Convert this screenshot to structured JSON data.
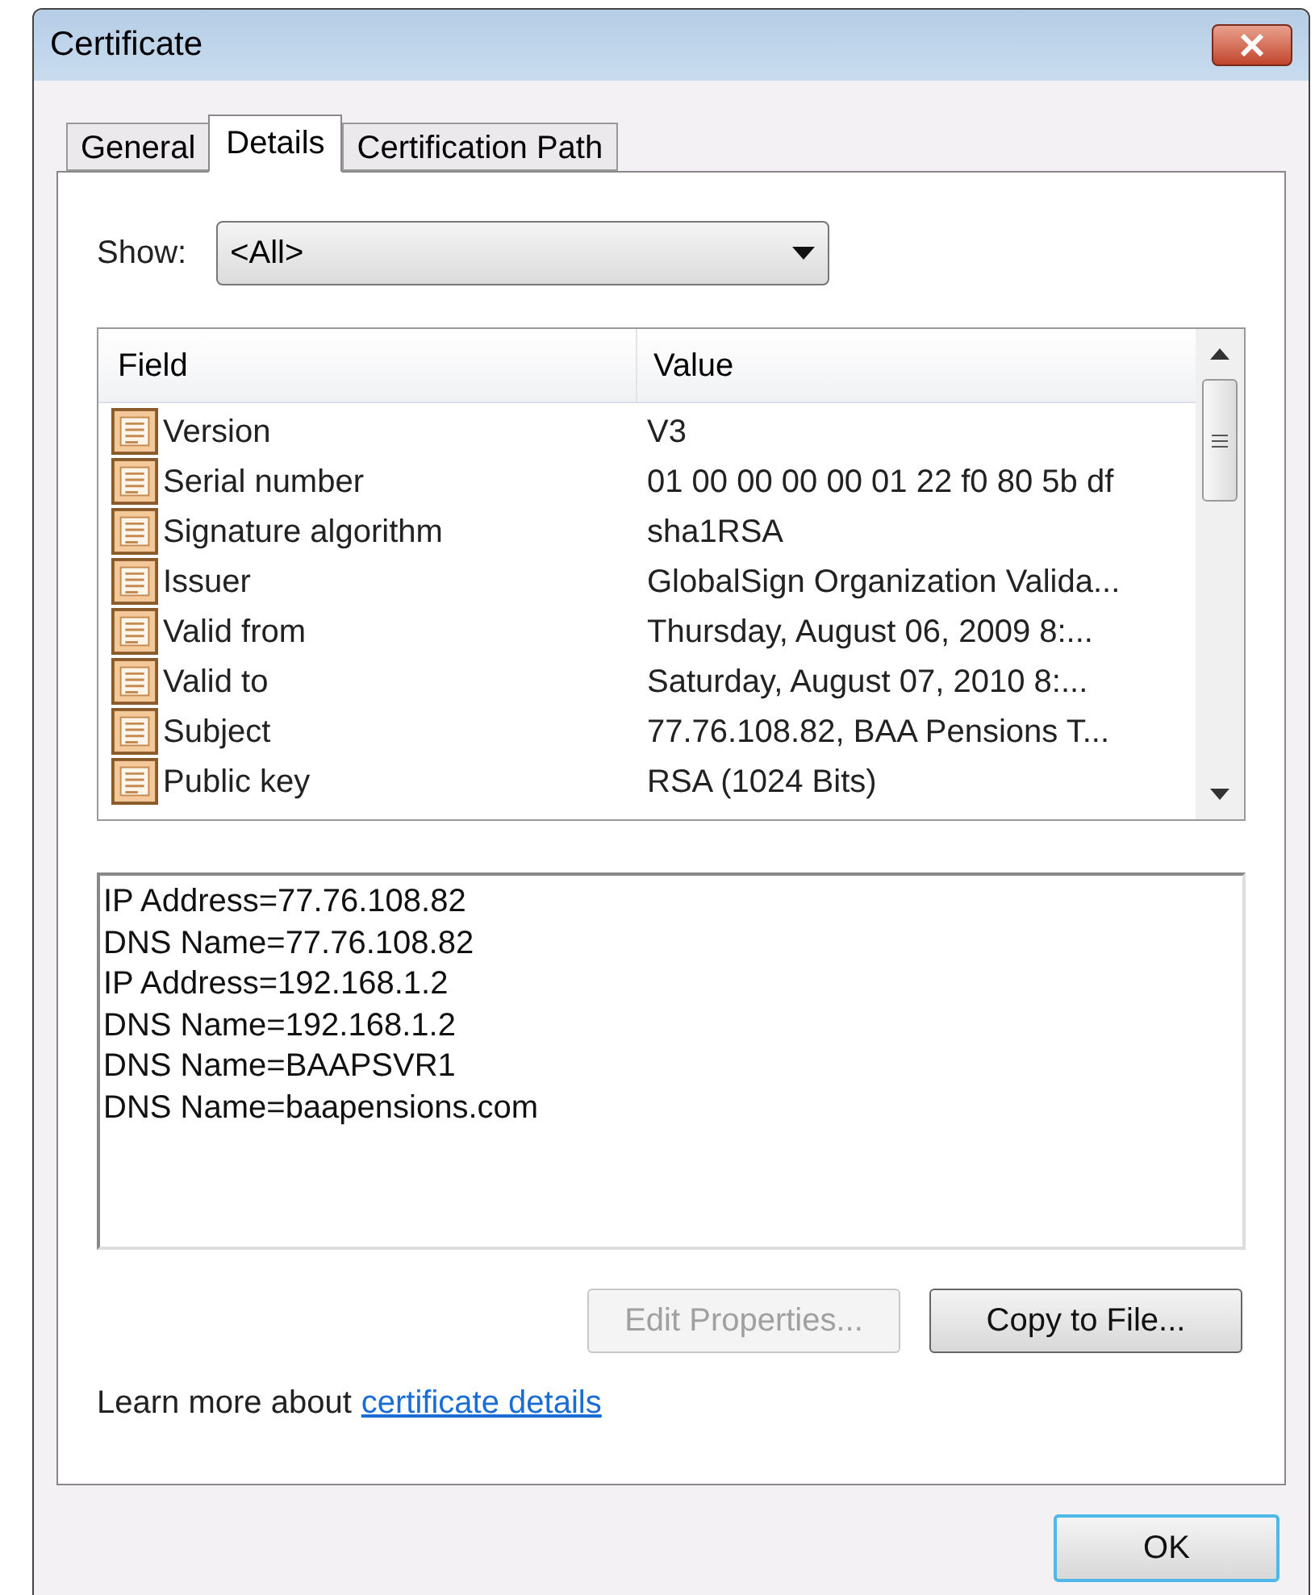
{
  "window": {
    "title": "Certificate"
  },
  "tabs": [
    {
      "label": "General",
      "selected": false
    },
    {
      "label": "Details",
      "selected": true
    },
    {
      "label": "Certification Path",
      "selected": false
    }
  ],
  "show": {
    "label": "Show:",
    "value": "<All>"
  },
  "table": {
    "columns": [
      "Field",
      "Value"
    ],
    "rows": [
      {
        "field": "Version",
        "value": "V3"
      },
      {
        "field": "Serial number",
        "value": "01 00 00 00 00 01 22 f0 80 5b df"
      },
      {
        "field": "Signature algorithm",
        "value": "sha1RSA"
      },
      {
        "field": "Issuer",
        "value": "GlobalSign Organization Valida..."
      },
      {
        "field": "Valid from",
        "value": "Thursday, August 06, 2009 8:..."
      },
      {
        "field": "Valid to",
        "value": "Saturday, August 07, 2010 8:..."
      },
      {
        "field": "Subject",
        "value": "77.76.108.82, BAA Pensions T..."
      },
      {
        "field": "Public key",
        "value": "RSA (1024 Bits)"
      }
    ]
  },
  "detail_lines": [
    "IP Address=77.76.108.82",
    "DNS Name=77.76.108.82",
    "IP Address=192.168.1.2",
    "DNS Name=192.168.1.2",
    "DNS Name=BAAPSVR1",
    "DNS Name=baapensions.com"
  ],
  "buttons": [
    {
      "label": "Edit Properties...",
      "disabled": true
    },
    {
      "label": "Copy to File...",
      "disabled": false
    }
  ],
  "learn_more": {
    "text": "Learn more about",
    "link": "certificate details"
  },
  "ok_button": "OK"
}
